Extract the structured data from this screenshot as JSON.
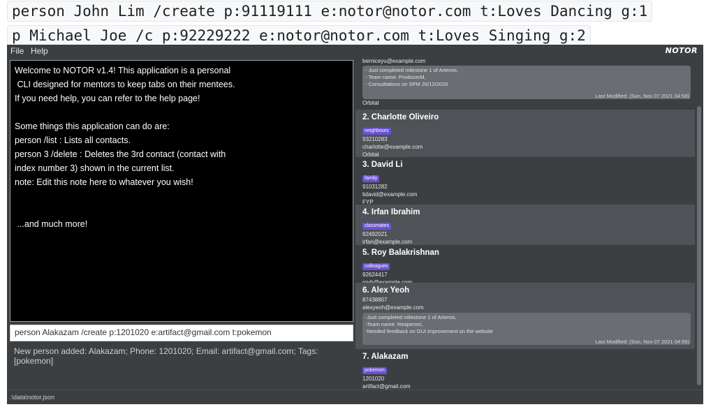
{
  "examples": {
    "cmd1": "person John Lim /create p:91119111 e:notor@notor.com t:Loves Dancing g:1",
    "cmd2": "p Michael Joe /c p:92229222 e:notor@notor.com t:Loves Singing g:2"
  },
  "menu": {
    "file": "File",
    "help": "Help"
  },
  "brand": "NOTOR",
  "help_lines": [
    "Welcome to NOTOR v1.4! This application is a personal",
    " CLI designed for mentors to keep tabs on their mentees.",
    "If you need help, you can refer to the help page!",
    "",
    "Some things this application can do are:",
    "person /list : Lists all contacts.",
    "person 3 /delete : Deletes the 3rd contact (contact with",
    "index number 3) shown in the current list.",
    "note: Edit this note here to whatever you wish!",
    "",
    "",
    " ...and much more!"
  ],
  "command_input": "person Alakazam /create p:1201020 e:artifact@gmail.com t:pokemon",
  "result": "New person added: Alakazam; Phone: 1201020; Email: artifact@gmail.com; Tags: [pokemon]",
  "cards": {
    "c1": {
      "email": "berniceyu@example.com",
      "notes": [
        "- Just completed milestone 1 of Artemis,",
        "- Team name: ProducerM,",
        "- Consultations on SPM 26/12/2020"
      ],
      "modified": "Last Modified: (Sun, Nov 07 2021 04:58)",
      "group": "Orbital"
    },
    "c2": {
      "name": "2.  Charlotte Oliveiro",
      "tag": "neighbours",
      "phone": "93210283",
      "email": "charlotte@example.com",
      "group": "Orbital"
    },
    "c3": {
      "name": "3.  David Li",
      "tag": "family",
      "phone": "91031282",
      "email": "lidavid@example.com",
      "group": "FYP"
    },
    "c4": {
      "name": "4.  Irfan Ibrahim",
      "tag": "classmates",
      "phone": "92492021",
      "email": "irfan@example.com"
    },
    "c5": {
      "name": "5.  Roy Balakrishnan",
      "tag": "colleagues",
      "phone": "92624417",
      "email": "royb@example.com"
    },
    "c6": {
      "name": "6.  Alex Yeoh",
      "phone": "87438807",
      "email": "alexyeoh@example.com",
      "notes": [
        "-Just completed milestone 1 of Artemis,",
        "-Team name: Reaperoni,",
        "-Needed feedback on GUI improvement on the website"
      ],
      "modified": "Last Modified: (Sun, Nov 07 2021 04:56)"
    },
    "c7": {
      "name": "7.  Alakazam",
      "tag": "pokemon",
      "phone": "1201020",
      "email": "artifact@gmail.com"
    }
  },
  "status_path": ".\\data\\notor.json",
  "colors": {
    "tag": "#6b52d1",
    "background": "#3c3f41",
    "card_light": "#4f5256"
  }
}
